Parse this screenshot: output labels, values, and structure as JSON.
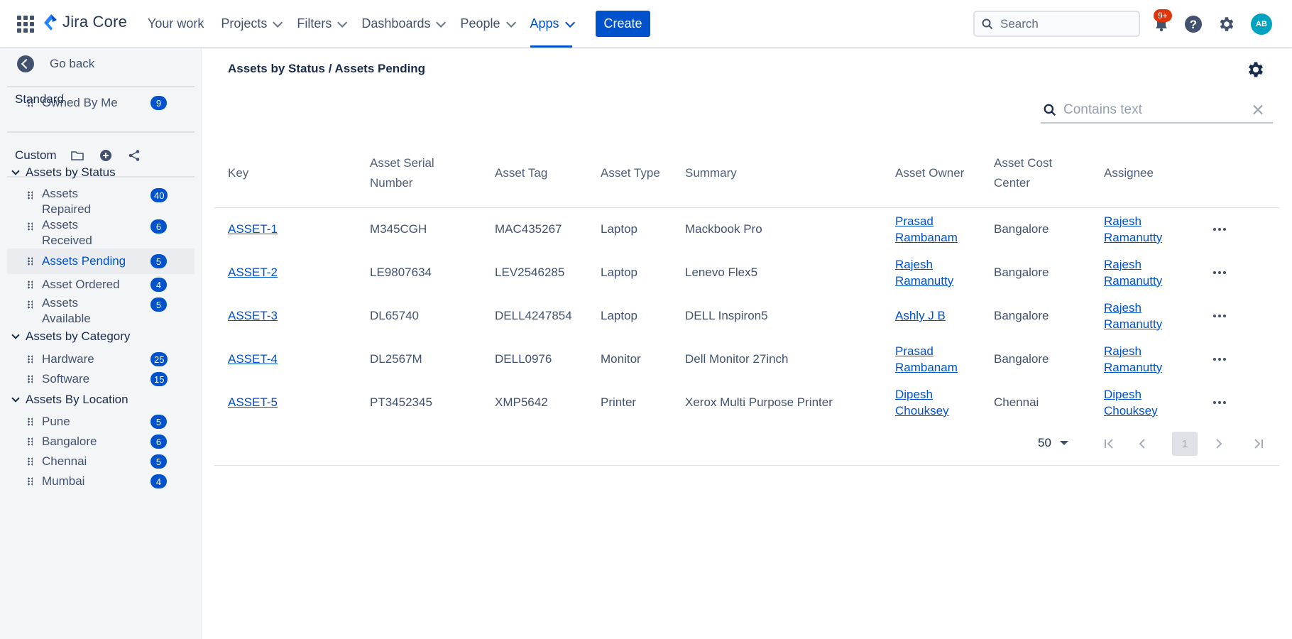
{
  "topnav": {
    "logo_text": "Jira Core",
    "items": [
      {
        "label": "Your work",
        "dropdown": false,
        "active": false
      },
      {
        "label": "Projects",
        "dropdown": true,
        "active": false
      },
      {
        "label": "Filters",
        "dropdown": true,
        "active": false
      },
      {
        "label": "Dashboards",
        "dropdown": true,
        "active": false
      },
      {
        "label": "People",
        "dropdown": true,
        "active": false
      },
      {
        "label": "Apps",
        "dropdown": true,
        "active": true
      }
    ],
    "create_label": "Create",
    "search_placeholder": "Search",
    "notification_badge": "9+",
    "avatar_initials": "AB",
    "brand_color": "#0052cc"
  },
  "sidebar": {
    "go_back": "Go back",
    "standard_label": "Standard",
    "standard_items": [
      {
        "label": "Owned By Me",
        "count": "9"
      }
    ],
    "custom_label": "Custom",
    "groups": [
      {
        "label": "Assets by Status",
        "items": [
          {
            "label": "Assets\nRepaired",
            "count": "40"
          },
          {
            "label": "Assets\nReceived",
            "count": "6"
          },
          {
            "label": "Assets Pending",
            "count": "5",
            "active": true
          },
          {
            "label": "Asset Ordered",
            "count": "4"
          },
          {
            "label": "Assets\nAvailable",
            "count": "5"
          }
        ]
      },
      {
        "label": "Assets by Category",
        "items": [
          {
            "label": "Hardware",
            "count": "25"
          },
          {
            "label": "Software",
            "count": "15"
          }
        ]
      },
      {
        "label": "Assets By Location",
        "items": [
          {
            "label": "Pune",
            "count": "5"
          },
          {
            "label": "Bangalore",
            "count": "6"
          },
          {
            "label": "Chennai",
            "count": "5"
          },
          {
            "label": "Mumbai",
            "count": "4"
          }
        ]
      }
    ]
  },
  "main": {
    "breadcrumb": "Assets by Status / Assets Pending",
    "filter_placeholder": "Contains text",
    "columns": [
      "Key",
      "Asset Serial Number",
      "Asset Tag",
      "Asset Type",
      "Summary",
      "Asset Owner",
      "Asset Cost Center",
      "Assignee"
    ],
    "rows": [
      {
        "key": "ASSET-1",
        "serial": "M345CGH",
        "tag": "MAC435267",
        "type": "Laptop",
        "summary": "Mackbook Pro",
        "owner": "Prasad Rambanam",
        "cost_center": "Bangalore",
        "assignee": "Rajesh Ramanutty"
      },
      {
        "key": "ASSET-2",
        "serial": "LE9807634",
        "tag": "LEV2546285",
        "type": "Laptop",
        "summary": "Lenevo Flex5",
        "owner": "Rajesh Ramanutty",
        "cost_center": "Bangalore",
        "assignee": "Rajesh Ramanutty"
      },
      {
        "key": "ASSET-3",
        "serial": "DL65740",
        "tag": "DELL4247854",
        "type": "Laptop",
        "summary": "DELL Inspiron5",
        "owner": "Ashly J B",
        "cost_center": "Bangalore",
        "assignee": "Rajesh Ramanutty"
      },
      {
        "key": "ASSET-4",
        "serial": "DL2567M",
        "tag": "DELL0976",
        "type": "Monitor",
        "summary": "Dell Monitor 27inch",
        "owner": "Prasad Rambanam",
        "cost_center": "Bangalore",
        "assignee": "Rajesh Ramanutty"
      },
      {
        "key": "ASSET-5",
        "serial": "PT3452345",
        "tag": "XMP5642",
        "type": "Printer",
        "summary": "Xerox Multi Purpose Printer",
        "owner": "Dipesh Chouksey",
        "cost_center": "Chennai",
        "assignee": "Dipesh Chouksey"
      }
    ],
    "pagination": {
      "page_size": "50",
      "current_page": "1"
    }
  }
}
